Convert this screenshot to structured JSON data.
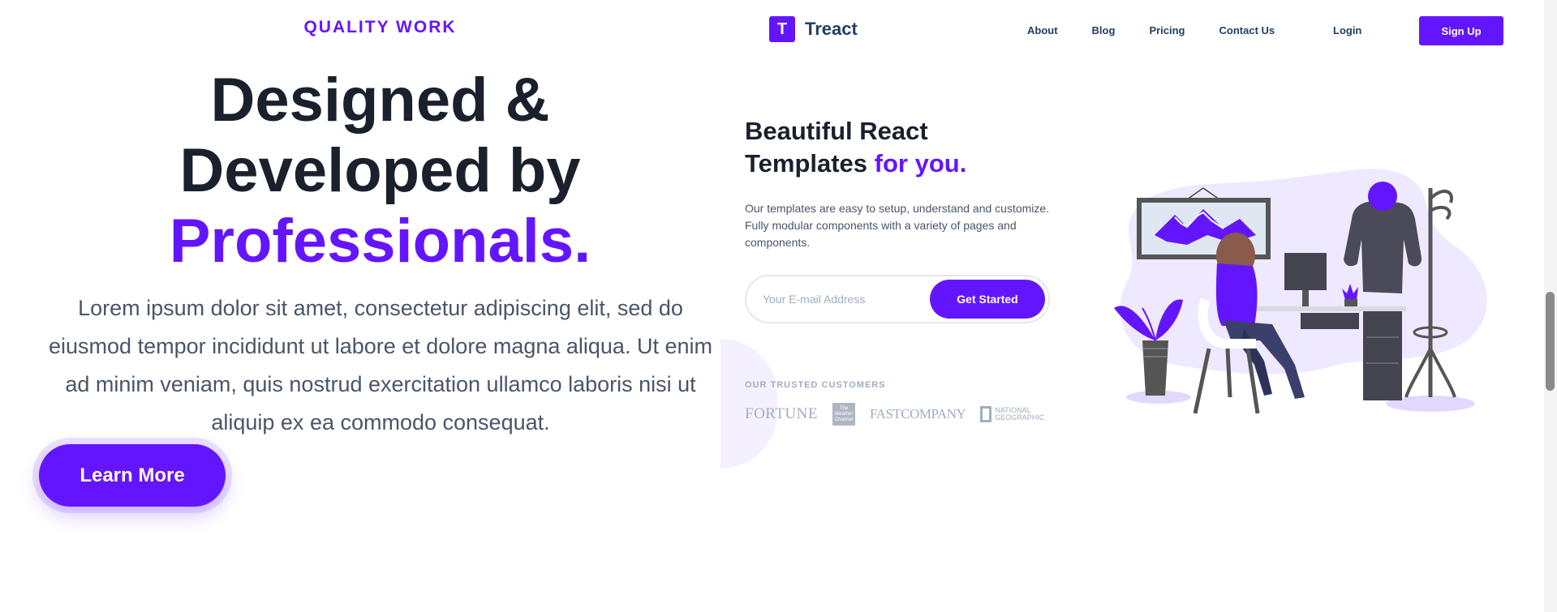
{
  "hero": {
    "eyebrow": "QUALITY WORK",
    "headline_line1": "Designed &",
    "headline_line2": "Developed by",
    "headline_accent": "Professionals.",
    "description": "Lorem ipsum dolor sit amet, consectetur adipiscing elit, sed do eiusmod tempor incididunt ut labore et dolore magna aliqua. Ut enim ad minim veniam, quis nostrud exercitation ullamco laboris nisi ut aliquip ex ea commodo consequat.",
    "cta_label": "Learn More"
  },
  "preview": {
    "logo_letter": "T",
    "brand": "Treact",
    "nav": [
      "About",
      "Blog",
      "Pricing",
      "Contact Us"
    ],
    "login_label": "Login",
    "signup_label": "Sign Up",
    "heading_part1": "Beautiful React Templates",
    "heading_accent": "for you.",
    "description": "Our templates are easy to setup, understand and customize. Fully modular components with a variety of pages and components.",
    "email_placeholder": "Your E-mail Address",
    "get_started_label": "Get Started",
    "trusted_label": "OUR TRUSTED CUSTOMERS",
    "customer_logos": {
      "fortune": "FORTUNE",
      "weather": "The Weather Channel",
      "fastcompany": "FASTCOMPANY",
      "natgeo": "NATIONAL GEOGRAPHIC"
    }
  },
  "colors": {
    "accent": "#6415ff",
    "heading": "#1a202c",
    "body_text": "#4a5568"
  },
  "icons": {
    "logo": "treact-logo-icon",
    "illustration": "woman-at-desk-illustration"
  }
}
